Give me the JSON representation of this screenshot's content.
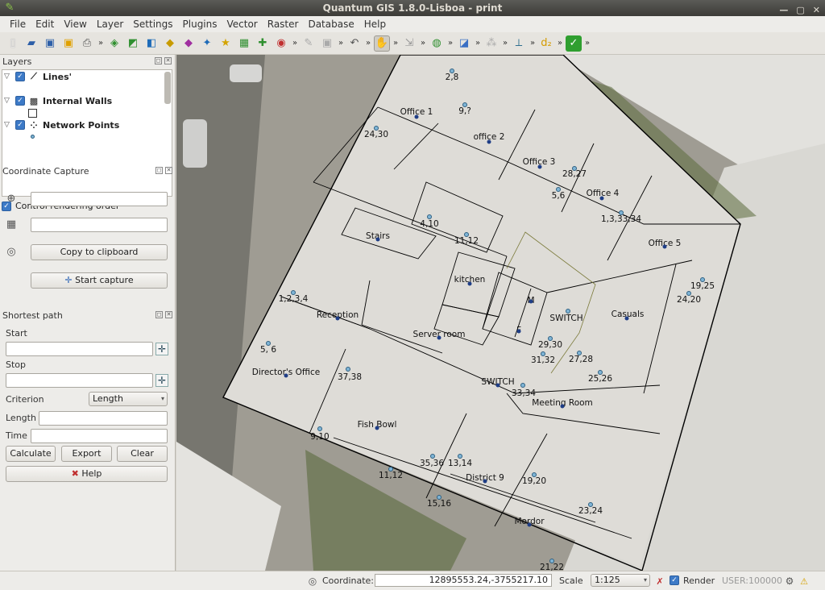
{
  "window": {
    "title": "Quantum GIS 1.8.0-Lisboa - print"
  },
  "menu": [
    "File",
    "Edit",
    "View",
    "Layer",
    "Settings",
    "Plugins",
    "Vector",
    "Raster",
    "Database",
    "Help"
  ],
  "toolbar_icons": [
    "new-project-icon",
    "open-project-icon",
    "save-project-icon",
    "save-as-icon",
    "print-composer-icon",
    "add-vector-layer-icon",
    "add-raster-layer-icon",
    "add-postgis-icon",
    "add-spatialite-icon",
    "add-wms-icon",
    "add-wfs-icon",
    "new-shapefile-icon",
    "pan-hand-icon",
    "zoom-icon",
    "identify-icon",
    "help-icon"
  ],
  "layers_panel": {
    "title": "Layers",
    "layers": [
      {
        "name": "Lines'",
        "checked": true
      },
      {
        "name": "Internal Walls",
        "checked": true
      },
      {
        "name": "Network Points",
        "checked": true
      }
    ],
    "control_rendering_label": "Control rendering order"
  },
  "coordinate_capture": {
    "title": "Coordinate Capture",
    "copy_button": "Copy to clipboard",
    "start_button": "Start capture"
  },
  "shortest_path": {
    "title": "Shortest path",
    "start_label": "Start",
    "stop_label": "Stop",
    "criterion_label": "Criterion",
    "criterion_value": "Length",
    "length_label": "Length",
    "time_label": "Time",
    "calculate_button": "Calculate",
    "export_button": "Export",
    "clear_button": "Clear",
    "help_button": "Help"
  },
  "map": {
    "rooms": [
      "Office 1",
      "office 2",
      "Office 3",
      "Office 4",
      "Office 5",
      "Stairs",
      "kitchen",
      "M",
      "F",
      "SWITCH",
      "Casuals",
      "Reception",
      "Server room",
      "Director's Office",
      "SWITCH",
      "Meeting Room",
      "Fish Bowl",
      "District 9",
      "Mordor"
    ],
    "network_points": [
      "2,8",
      "9,?",
      "24,30",
      "28,27",
      "5,6",
      "1,3,33,34",
      "4,10",
      "11,12",
      "19,25",
      "24,20",
      "1,2,3,4",
      "29,30",
      "31,32",
      "27,28",
      "5, 6",
      "37,38",
      "25,26",
      "33,34",
      "9,10",
      "35,36",
      "13,14",
      "11,12",
      "19,20",
      "15,16",
      "23,24",
      "21,22"
    ]
  },
  "status": {
    "coordinate_label": "Coordinate:",
    "coordinate_value": "12895553.24,-3755217.10",
    "scale_label": "Scale",
    "scale_value": "1:125",
    "render_label": "Render",
    "crs": "USER:100000"
  }
}
